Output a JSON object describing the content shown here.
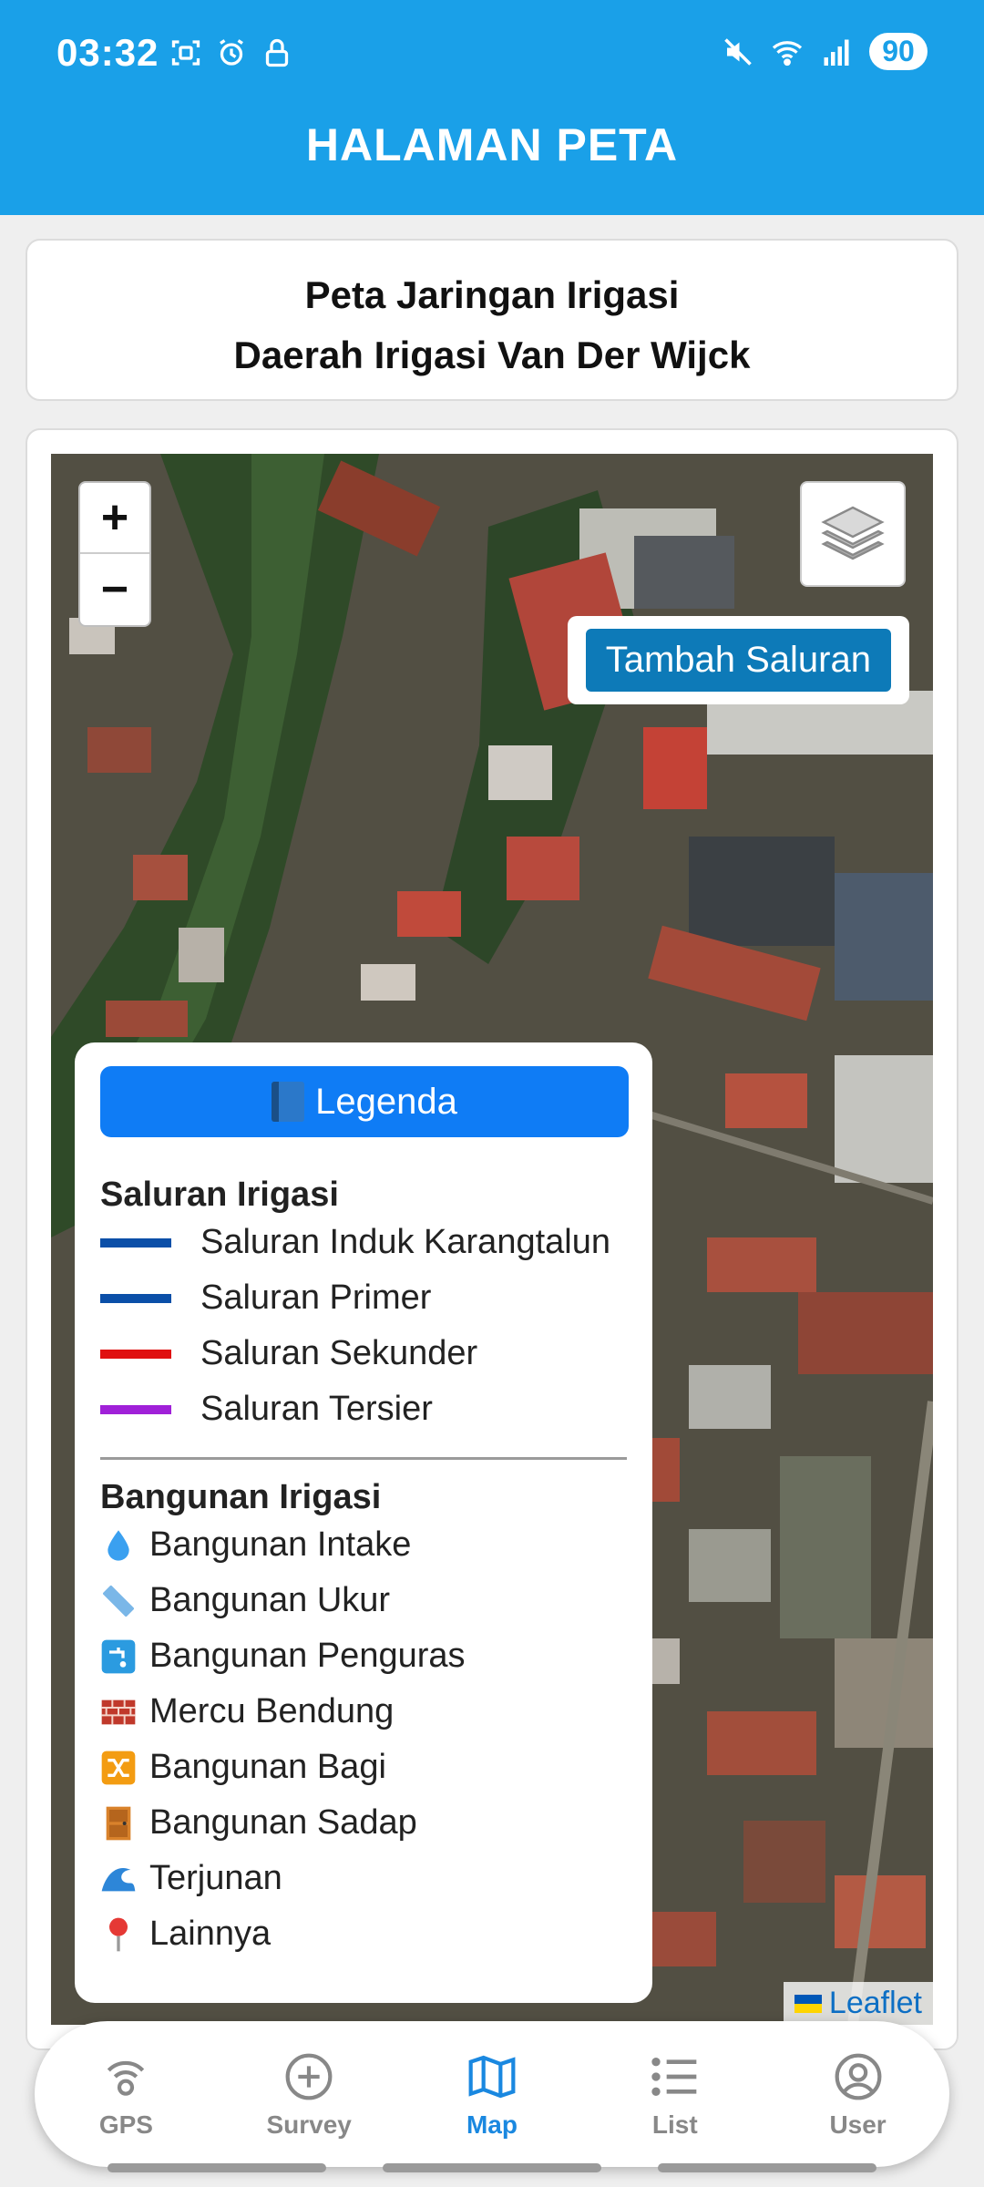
{
  "status_bar": {
    "time": "03:32",
    "battery": "90"
  },
  "header": {
    "title": "HALAMAN PETA"
  },
  "title_card": {
    "line1": "Peta Jaringan Irigasi",
    "line2": "Daerah Irigasi Van Der Wijck"
  },
  "map": {
    "zoom_in": "+",
    "zoom_out": "−",
    "add_channel": "Tambah Saluran",
    "attribution": "Leaflet"
  },
  "legend": {
    "button": "Legenda",
    "channels_title": "Saluran Irigasi",
    "channels": [
      {
        "label": "Saluran Induk Karangtalun",
        "color": "#0b4fa8"
      },
      {
        "label": "Saluran Primer",
        "color": "#0b4fa8"
      },
      {
        "label": "Saluran Sekunder",
        "color": "#e01010"
      },
      {
        "label": "Saluran Tersier",
        "color": "#a020d8"
      }
    ],
    "buildings_title": "Bangunan Irigasi",
    "buildings": [
      {
        "label": "Bangunan Intake",
        "icon": "droplet-icon"
      },
      {
        "label": "Bangunan Ukur",
        "icon": "ruler-icon"
      },
      {
        "label": "Bangunan Penguras",
        "icon": "faucet-icon"
      },
      {
        "label": "Mercu Bendung",
        "icon": "brick-icon"
      },
      {
        "label": "Bangunan Bagi",
        "icon": "shuffle-icon"
      },
      {
        "label": "Bangunan Sadap",
        "icon": "door-icon"
      },
      {
        "label": "Terjunan",
        "icon": "wave-icon"
      },
      {
        "label": "Lainnya",
        "icon": "pin-icon"
      }
    ]
  },
  "nav": [
    {
      "label": "GPS",
      "icon": "gps-icon"
    },
    {
      "label": "Survey",
      "icon": "plus-circle-icon"
    },
    {
      "label": "Map",
      "icon": "map-icon"
    },
    {
      "label": "List",
      "icon": "list-icon"
    },
    {
      "label": "User",
      "icon": "user-icon"
    }
  ],
  "colors": {
    "header": "#1aa0e8",
    "accent": "#0f7cf5",
    "nav_active": "#1a88e0"
  }
}
